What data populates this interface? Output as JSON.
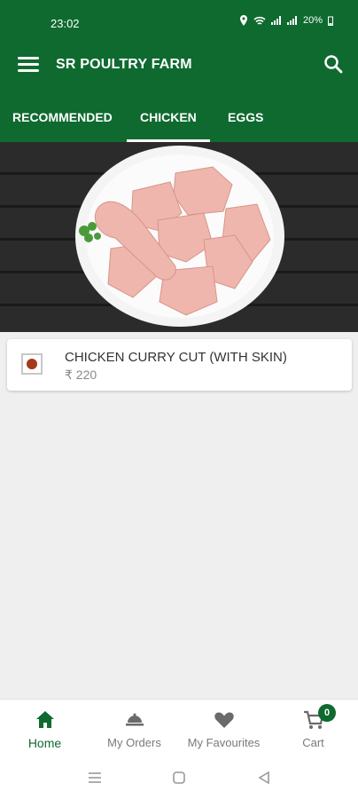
{
  "status": {
    "time": "23:02",
    "battery": "20%"
  },
  "appbar": {
    "title": "SR POULTRY FARM",
    "menu_icon": "menu-icon",
    "search_icon": "search-icon"
  },
  "tabs": [
    {
      "label": "RECOMMENDED"
    },
    {
      "label": "CHICKEN",
      "selected": true
    },
    {
      "label": "EGGS"
    }
  ],
  "banner": {
    "subject": "plate of raw chicken pieces"
  },
  "products": [
    {
      "name": "CHICKEN CURRY CUT (WITH SKIN)",
      "price": "₹ 220",
      "marker_color": "#a53a1a"
    }
  ],
  "bottom_nav": {
    "items": [
      {
        "label": "Home",
        "icon": "home-icon",
        "active": true
      },
      {
        "label": "My Orders",
        "icon": "orders-icon"
      },
      {
        "label": "My Favourites",
        "icon": "heart-icon"
      },
      {
        "label": "Cart",
        "icon": "cart-icon",
        "badge": "0"
      }
    ]
  },
  "colors": {
    "primary": "#0f6a2f",
    "background": "#efefef"
  }
}
